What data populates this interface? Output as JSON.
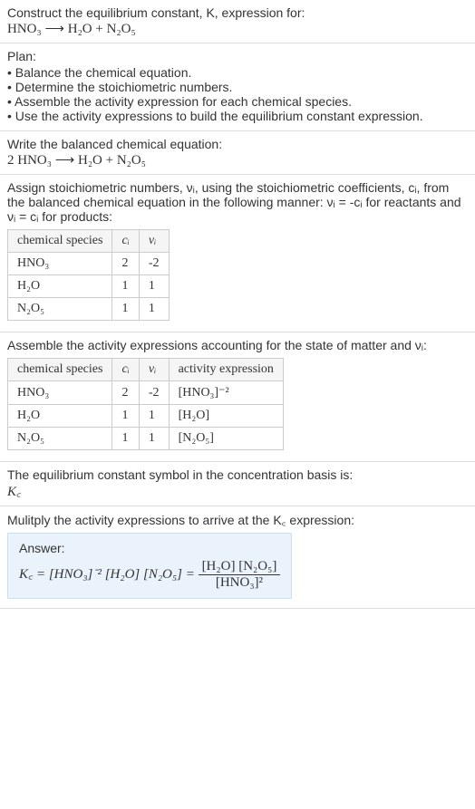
{
  "header": {
    "prompt": "Construct the equilibrium constant, K, expression for:",
    "equation": "HNO₃ ⟶ H₂O + N₂O₅"
  },
  "plan": {
    "title": "Plan:",
    "items": [
      "Balance the chemical equation.",
      "Determine the stoichiometric numbers.",
      "Assemble the activity expression for each chemical species.",
      "Use the activity expressions to build the equilibrium constant expression."
    ]
  },
  "balanced": {
    "intro": "Write the balanced chemical equation:",
    "equation": "2 HNO₃ ⟶ H₂O + N₂O₅"
  },
  "stoich": {
    "intro": "Assign stoichiometric numbers, νᵢ, using the stoichiometric coefficients, cᵢ, from the balanced chemical equation in the following manner: νᵢ = -cᵢ for reactants and νᵢ = cᵢ for products:",
    "headers": {
      "species": "chemical species",
      "c": "cᵢ",
      "v": "νᵢ"
    },
    "rows": [
      {
        "species": "HNO₃",
        "c": "2",
        "v": "-2"
      },
      {
        "species": "H₂O",
        "c": "1",
        "v": "1"
      },
      {
        "species": "N₂O₅",
        "c": "1",
        "v": "1"
      }
    ]
  },
  "activity": {
    "intro": "Assemble the activity expressions accounting for the state of matter and νᵢ:",
    "headers": {
      "species": "chemical species",
      "c": "cᵢ",
      "v": "νᵢ",
      "expr": "activity expression"
    },
    "rows": [
      {
        "species": "HNO₃",
        "c": "2",
        "v": "-2",
        "expr": "[HNO₃]⁻²"
      },
      {
        "species": "H₂O",
        "c": "1",
        "v": "1",
        "expr": "[H₂O]"
      },
      {
        "species": "N₂O₅",
        "c": "1",
        "v": "1",
        "expr": "[N₂O₅]"
      }
    ]
  },
  "symbol": {
    "intro": "The equilibrium constant symbol in the concentration basis is:",
    "value": "K꜀"
  },
  "multiply": {
    "intro": "Mulitply the activity expressions to arrive at the K꜀ expression:"
  },
  "answer": {
    "label": "Answer:",
    "lhs": "K꜀ = [HNO₃]⁻² [H₂O] [N₂O₅] = ",
    "num": "[H₂O] [N₂O₅]",
    "den": "[HNO₃]²"
  },
  "chart_data": {
    "type": "table",
    "title": "Stoichiometric numbers and activity expressions for HNO₃ → H₂O + N₂O₅",
    "columns": [
      "chemical species",
      "cᵢ",
      "νᵢ",
      "activity expression"
    ],
    "rows": [
      [
        "HNO₃",
        2,
        -2,
        "[HNO₃]⁻²"
      ],
      [
        "H₂O",
        1,
        1,
        "[H₂O]"
      ],
      [
        "N₂O₅",
        1,
        1,
        "[N₂O₅]"
      ]
    ]
  }
}
